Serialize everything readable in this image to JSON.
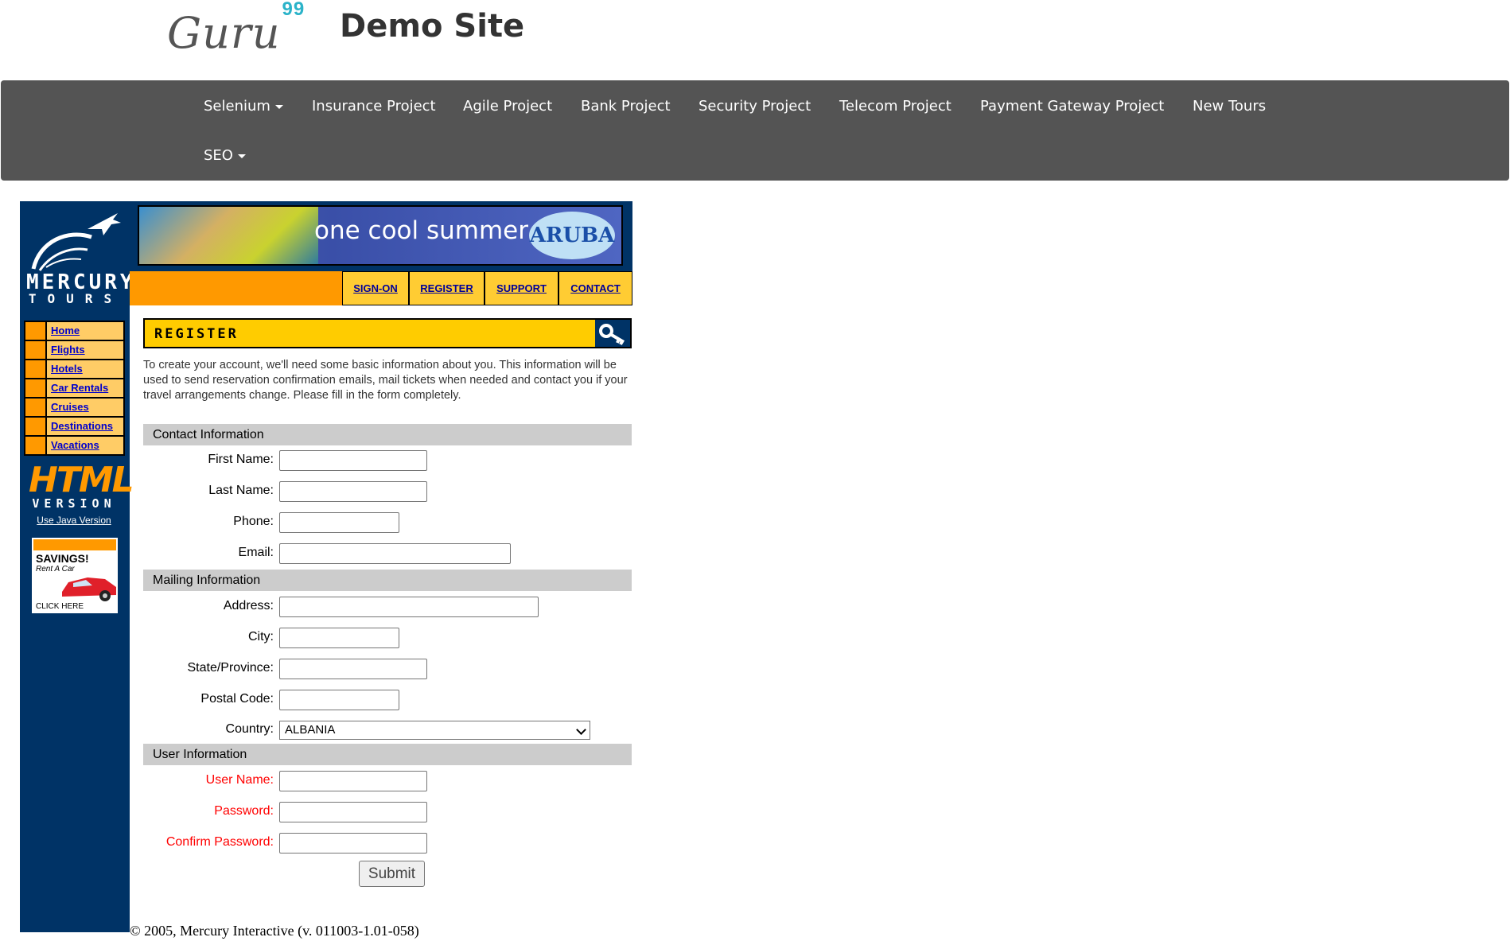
{
  "site": {
    "logo_text": "Guru",
    "logo_sup": "99",
    "title": "Demo Site"
  },
  "nav": {
    "items": [
      {
        "label": "Selenium",
        "dropdown": true
      },
      {
        "label": "Insurance Project",
        "dropdown": false
      },
      {
        "label": "Agile Project",
        "dropdown": false
      },
      {
        "label": "Bank Project",
        "dropdown": false
      },
      {
        "label": "Security Project",
        "dropdown": false
      },
      {
        "label": "Telecom Project",
        "dropdown": false
      },
      {
        "label": "Payment Gateway Project",
        "dropdown": false
      },
      {
        "label": "New Tours",
        "dropdown": false
      },
      {
        "label": "SEO",
        "dropdown": true
      }
    ]
  },
  "mercury": {
    "logo_word1": "MERCURY",
    "logo_word2": "TOURS",
    "side_menu": [
      "Home",
      "Flights",
      "Hotels",
      "Car Rentals",
      "Cruises",
      "Destinations",
      "Vacations"
    ],
    "html_version_big": "HTML",
    "html_version_small": "VERSION",
    "java_link": "Use Java Version",
    "savings_ad": {
      "title": "SAVINGS!",
      "subtitle": "Rent A Car",
      "cta": "CLICK HERE"
    },
    "banner": {
      "text": "one cool summer",
      "brand": "ARUBA"
    },
    "top_links": [
      "SIGN-ON",
      "REGISTER",
      "SUPPORT",
      "CONTACT"
    ],
    "page_heading": "REGISTER",
    "intro": "To create your account, we'll need some basic information about you. This information will be used to send reservation confirmation emails, mail tickets when needed and contact you if your travel arrangements change. Please fill in the form completely.",
    "sections": {
      "contact": "Contact Information",
      "mailing": "Mailing Information",
      "user": "User Information"
    },
    "fields": {
      "first_name": {
        "label": "First Name:",
        "value": ""
      },
      "last_name": {
        "label": "Last Name:",
        "value": ""
      },
      "phone": {
        "label": "Phone:",
        "value": ""
      },
      "email": {
        "label": "Email:",
        "value": ""
      },
      "address": {
        "label": "Address:",
        "value": ""
      },
      "city": {
        "label": "City:",
        "value": ""
      },
      "state": {
        "label": "State/Province:",
        "value": ""
      },
      "postal": {
        "label": "Postal Code:",
        "value": ""
      },
      "country": {
        "label": "Country:",
        "value": "ALBANIA"
      },
      "username": {
        "label": "User Name:",
        "value": ""
      },
      "password": {
        "label": "Password:",
        "value": ""
      },
      "confirm": {
        "label": "Confirm Password:",
        "value": ""
      }
    },
    "submit_label": "Submit",
    "footer": "© 2005, Mercury Interactive (v. 011003-1.01-058)"
  },
  "colors": {
    "navbar": "#545454",
    "mercury_blue": "#003366",
    "orange": "#ff9900",
    "heading_yellow": "#ffcc00",
    "required_red": "#ff0000"
  }
}
